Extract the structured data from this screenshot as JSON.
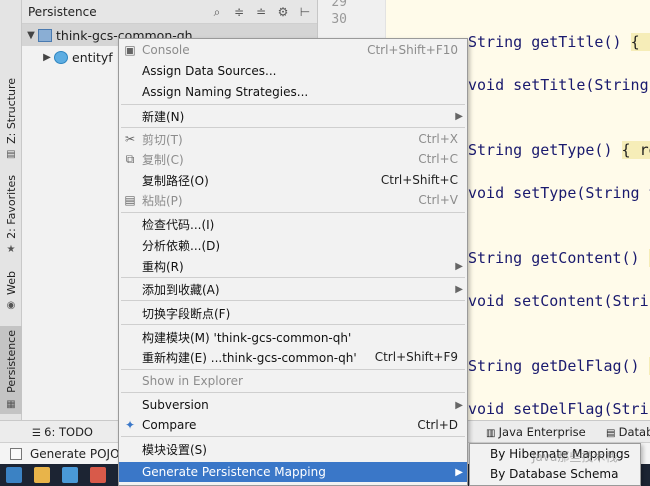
{
  "left_strip": {
    "tabs": [
      {
        "label": "Z: Structure",
        "icon": "structure-icon"
      },
      {
        "label": "2: Favorites",
        "icon": "star-icon"
      },
      {
        "label": "Web",
        "icon": "globe-icon"
      },
      {
        "label": "Persistence",
        "icon": "persistence-icon"
      }
    ]
  },
  "panel": {
    "title": "Persistence",
    "tree": [
      {
        "label": "think-gcs-common-qh",
        "icon": "module-icon"
      },
      {
        "label": "entityf",
        "icon": "entity-icon"
      }
    ]
  },
  "editor": {
    "line_numbers": [
      "29",
      "30"
    ],
    "code_lines": [
      {
        "code": "String getTitle() ",
        "brace": "{ r"
      },
      {
        "code": "void setTitle(String",
        "brace": ""
      },
      {
        "code": "String getType() ",
        "brace": "{ re"
      },
      {
        "code": "void setType(String t",
        "brace": ""
      },
      {
        "code": "String getContent() ",
        "brace": "{"
      },
      {
        "code": "void setContent(Strin",
        "brace": ""
      },
      {
        "code": "String getDelFlag() ",
        "brace": "{"
      },
      {
        "code": "void setDelFlag(Strin",
        "brace": ""
      }
    ]
  },
  "bottom_bar": {
    "todo": "6: TODO",
    "java_enterprise": "Java Enterprise",
    "database": "Datab"
  },
  "status_bar": {
    "text": "Generate POJO"
  },
  "context_menu": {
    "items": {
      "console": {
        "label": "Console",
        "shortcut": "Ctrl+Shift+F10"
      },
      "assign_data_sources": {
        "label": "Assign Data Sources..."
      },
      "assign_naming": {
        "label": "Assign Naming Strategies..."
      },
      "new": {
        "label": "新建(N)"
      },
      "cut": {
        "label": "剪切(T)",
        "shortcut": "Ctrl+X"
      },
      "copy": {
        "label": "复制(C)",
        "shortcut": "Ctrl+C"
      },
      "copy_path": {
        "label": "复制路径(O)",
        "shortcut": "Ctrl+Shift+C"
      },
      "paste": {
        "label": "粘贴(P)",
        "shortcut": "Ctrl+V"
      },
      "inspect_code": {
        "label": "检查代码...(I)"
      },
      "analyze_deps": {
        "label": "分析依赖...(D)"
      },
      "refactor": {
        "label": "重构(R)"
      },
      "add_to_favorites": {
        "label": "添加到收藏(A)"
      },
      "toggle_field_breakpoint": {
        "label": "切换字段断点(F)"
      },
      "build_module": {
        "label": "构建模块(M) 'think-gcs-common-qh'"
      },
      "rebuild": {
        "label": "重新构建(E) ...think-gcs-common-qh'",
        "shortcut": "Ctrl+Shift+F9"
      },
      "show_in_explorer": {
        "label": "Show in Explorer"
      },
      "subversion": {
        "label": "Subversion"
      },
      "compare": {
        "label": "Compare",
        "shortcut": "Ctrl+D"
      },
      "module_settings": {
        "label": "模块设置(S)"
      },
      "generate_persistence": {
        "label": "Generate Persistence Mapping"
      }
    }
  },
  "submenu": {
    "items": [
      "By Hibernate Mappings",
      "By Database Schema"
    ]
  },
  "watermark": "Java那些技术栈",
  "colors": {
    "menu_highlight": "#3a77c8",
    "editor_bg": "#fffbea",
    "keyword": "#1a1a6e"
  }
}
